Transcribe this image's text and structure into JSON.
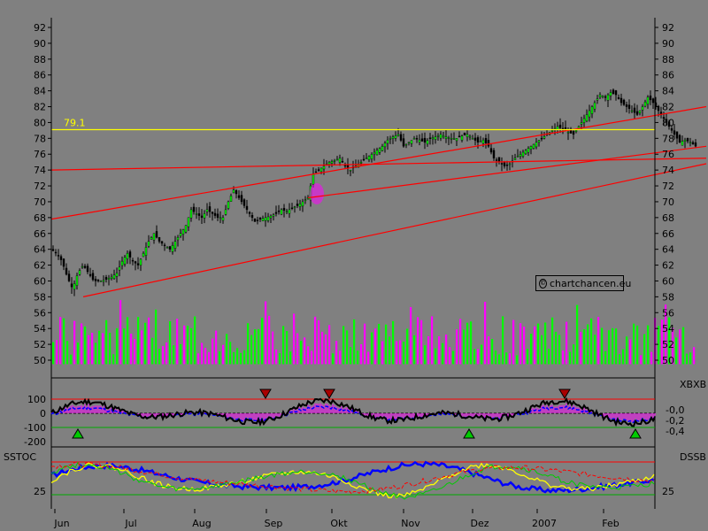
{
  "chart_data": [
    {
      "type": "candlestick",
      "x_labels": [
        "Jun",
        "Jul",
        "Aug",
        "Sep",
        "Okt",
        "Nov",
        "Dez",
        "2007",
        "Feb"
      ],
      "y_ticks": [
        50,
        52,
        54,
        56,
        58,
        60,
        62,
        64,
        66,
        68,
        70,
        72,
        74,
        76,
        78,
        80,
        82,
        84,
        86,
        88,
        90,
        92
      ],
      "ylim": [
        48.5,
        93
      ],
      "horizontal_line": {
        "value": 79.1,
        "label": "79.1"
      },
      "price_path": [
        [
          0,
          64
        ],
        [
          6,
          63.5
        ],
        [
          12,
          62.5
        ],
        [
          18,
          60.5
        ],
        [
          24,
          59
        ],
        [
          30,
          61
        ],
        [
          36,
          62
        ],
        [
          42,
          61
        ],
        [
          48,
          60
        ],
        [
          56,
          60
        ],
        [
          62,
          60.2
        ],
        [
          68,
          60.5
        ],
        [
          74,
          61
        ],
        [
          80,
          62.5
        ],
        [
          86,
          63.5
        ],
        [
          92,
          62.5
        ],
        [
          98,
          62
        ],
        [
          104,
          63.5
        ],
        [
          110,
          65
        ],
        [
          116,
          66
        ],
        [
          122,
          65
        ],
        [
          128,
          64.5
        ],
        [
          134,
          64
        ],
        [
          140,
          65
        ],
        [
          146,
          66
        ],
        [
          152,
          67
        ],
        [
          158,
          69
        ],
        [
          164,
          68.5
        ],
        [
          170,
          68
        ],
        [
          176,
          69
        ],
        [
          182,
          68.5
        ],
        [
          188,
          68
        ],
        [
          194,
          68
        ],
        [
          200,
          70
        ],
        [
          206,
          71.5
        ],
        [
          212,
          70.5
        ],
        [
          218,
          69.5
        ],
        [
          224,
          68.5
        ],
        [
          230,
          67.5
        ],
        [
          236,
          67.8
        ],
        [
          242,
          68
        ],
        [
          248,
          68.2
        ],
        [
          254,
          68.5
        ],
        [
          260,
          69
        ],
        [
          266,
          68.8
        ],
        [
          272,
          69.2
        ],
        [
          278,
          69.5
        ],
        [
          284,
          70
        ],
        [
          290,
          70.5
        ],
        [
          296,
          73.5
        ],
        [
          302,
          74
        ],
        [
          308,
          74.5
        ],
        [
          314,
          75
        ],
        [
          320,
          75.2
        ],
        [
          326,
          75.5
        ],
        [
          332,
          74.5
        ],
        [
          338,
          74
        ],
        [
          344,
          74.5
        ],
        [
          350,
          75
        ],
        [
          356,
          75.5
        ],
        [
          362,
          76
        ],
        [
          368,
          76.5
        ],
        [
          374,
          77
        ],
        [
          380,
          77.8
        ],
        [
          386,
          78.2
        ],
        [
          392,
          78.5
        ],
        [
          398,
          77
        ],
        [
          404,
          77.5
        ],
        [
          410,
          78
        ],
        [
          416,
          77.8
        ],
        [
          422,
          77.5
        ],
        [
          428,
          78
        ],
        [
          434,
          78.2
        ],
        [
          440,
          78.5
        ],
        [
          446,
          78.2
        ],
        [
          452,
          78
        ],
        [
          458,
          78
        ],
        [
          464,
          78.3
        ],
        [
          470,
          78.5
        ],
        [
          476,
          78
        ],
        [
          482,
          77.5
        ],
        [
          488,
          77.8
        ],
        [
          494,
          77
        ],
        [
          500,
          75.5
        ],
        [
          506,
          75
        ],
        [
          512,
          74.5
        ],
        [
          518,
          74.8
        ],
        [
          524,
          75.5
        ],
        [
          530,
          76
        ],
        [
          536,
          76.5
        ],
        [
          542,
          77
        ],
        [
          548,
          77.5
        ],
        [
          554,
          78
        ],
        [
          560,
          78.5
        ],
        [
          566,
          79
        ],
        [
          572,
          79.5
        ],
        [
          578,
          79.2
        ],
        [
          584,
          78.8
        ],
        [
          590,
          78.5
        ],
        [
          596,
          79.5
        ],
        [
          602,
          80.5
        ],
        [
          608,
          81.5
        ],
        [
          614,
          82.5
        ],
        [
          620,
          83.5
        ],
        [
          626,
          83.2
        ],
        [
          632,
          83.8
        ],
        [
          638,
          83.5
        ],
        [
          644,
          82.5
        ],
        [
          650,
          82
        ],
        [
          656,
          81.5
        ],
        [
          662,
          81
        ],
        [
          668,
          82
        ],
        [
          674,
          83.2
        ],
        [
          680,
          82.5
        ],
        [
          686,
          81.5
        ],
        [
          692,
          80.5
        ],
        [
          698,
          79.5
        ],
        [
          704,
          78.5
        ],
        [
          710,
          77.5
        ],
        [
          716,
          77.8
        ],
        [
          722,
          77.5
        ],
        [
          728,
          77
        ]
      ],
      "trend_lines": [
        {
          "from": [
            0,
            74
          ],
          "to": [
            740,
            75.5
          ]
        },
        {
          "from": [
            0,
            67.8
          ],
          "to": [
            740,
            82
          ]
        },
        {
          "from": [
            36,
            58
          ],
          "to": [
            740,
            74.8
          ]
        },
        {
          "from": [
            290,
            70.5
          ],
          "to": [
            740,
            77
          ]
        }
      ],
      "volume_bars": {
        "y_ticks": [
          50,
          52,
          54,
          56
        ],
        "note": "alternating green/magenta"
      },
      "colors": {
        "up": "#00ff00",
        "down": "#ff00ff",
        "trend": "#ff0000",
        "level": "#ffff00",
        "candle": "#000000"
      }
    },
    {
      "type": "line",
      "name": "XBXB",
      "y_ticks_left": [
        100,
        0,
        -100,
        -200
      ],
      "y_ticks_right": [
        "-0,0",
        "-0,2",
        "-0,4"
      ],
      "markers": {
        "sell": [
          300,
          372,
          638
        ],
        "buy": [
          88,
          530,
          718
        ]
      }
    },
    {
      "type": "line",
      "name_left": "SSTOC",
      "name_right": "DSSB",
      "y_ticks_left": [
        25
      ],
      "y_ticks_right": [
        25
      ]
    }
  ],
  "watermark": "chartchancen.eu"
}
